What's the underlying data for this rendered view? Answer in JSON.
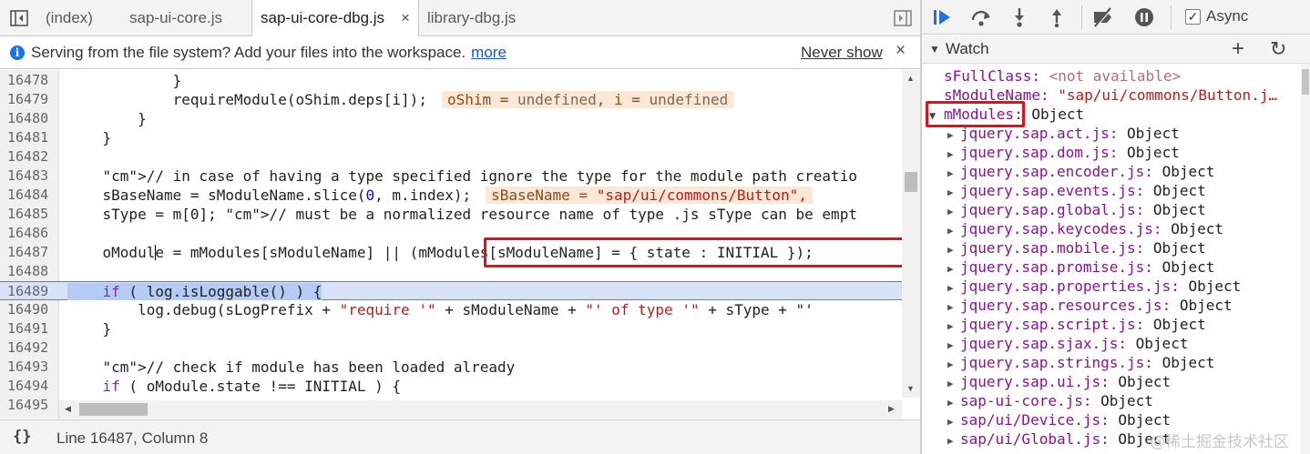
{
  "editor": {
    "tabs": [
      {
        "label": "(index)"
      },
      {
        "label": "sap-ui-core.js"
      },
      {
        "label": "sap-ui-core-dbg.js",
        "active": true
      },
      {
        "label": "library-dbg.js"
      }
    ],
    "tab_close": "×",
    "infobar": {
      "message": "Serving from the file system? Add your files into the workspace.",
      "link": "more",
      "never_show": "Never show",
      "close": "×"
    },
    "lines": [
      {
        "n": "16478",
        "code": "            }"
      },
      {
        "n": "16479",
        "code": "            requireModule(oShim.deps[i]);"
      },
      {
        "n": "16480",
        "code": "        }"
      },
      {
        "n": "16481",
        "code": "    }"
      },
      {
        "n": "16482",
        "code": ""
      },
      {
        "n": "16483",
        "code": "    // in case of having a type specified ignore the type for the module path creatio"
      },
      {
        "n": "16484",
        "code": "    sBaseName = sModuleName.slice(0, m.index);"
      },
      {
        "n": "16485",
        "code": "    sType = m[0]; // must be a normalized resource name of type .js sType can be empt"
      },
      {
        "n": "16486",
        "code": ""
      },
      {
        "n": "16487",
        "code": "    oModule = mModules[sModuleName] || (mModules[sModuleName] = { state : INITIAL });"
      },
      {
        "n": "16488",
        "code": ""
      },
      {
        "n": "16489",
        "code": "    if ( log.isLoggable() ) {"
      },
      {
        "n": "16490",
        "code": "        log.debug(sLogPrefix + \"require '\" + sModuleName + \"' of type '\" + sType + \"'"
      },
      {
        "n": "16491",
        "code": "    }"
      },
      {
        "n": "16492",
        "code": ""
      },
      {
        "n": "16493",
        "code": "    // check if module has been loaded already"
      },
      {
        "n": "16494",
        "code": "    if ( oModule.state !== INITIAL ) {"
      },
      {
        "n": "16495",
        "code": ""
      }
    ],
    "inline_values": {
      "line_16479": {
        "a": "oShim = ",
        "a_val": "undefined",
        "b": ", i = ",
        "b_val": "undefined"
      },
      "line_16484": {
        "a": "sBaseName = ",
        "a_val": "\"sap/ui/commons/Button\","
      }
    },
    "status": {
      "braces": "{}",
      "position": "Line 16487, Column 8"
    }
  },
  "debugger": {
    "async_label": "Async",
    "async_checked": true,
    "watch": {
      "title": "Watch",
      "add": "+",
      "refresh": "↻",
      "entries": [
        {
          "key": "sFullClass",
          "value": "<not available>",
          "kind": "na"
        },
        {
          "key": "sModuleName",
          "value": "\"sap/ui/commons/Button.j…",
          "kind": "str"
        },
        {
          "key": "mModules",
          "value": "Object",
          "kind": "obj",
          "expanded": true
        }
      ],
      "children": [
        "jquery.sap.act.js",
        "jquery.sap.dom.js",
        "jquery.sap.encoder.js",
        "jquery.sap.events.js",
        "jquery.sap.global.js",
        "jquery.sap.keycodes.js",
        "jquery.sap.mobile.js",
        "jquery.sap.promise.js",
        "jquery.sap.properties.js",
        "jquery.sap.resources.js",
        "jquery.sap.script.js",
        "jquery.sap.sjax.js",
        "jquery.sap.strings.js",
        "jquery.sap.ui.js",
        "sap-ui-core.js",
        "sap/ui/Device.js",
        "sap/ui/Global.js"
      ],
      "child_value": "Object"
    }
  },
  "watermark": "@稀土掘金技术社区",
  "colors": {
    "highlight_line": "#d8e3fa",
    "red_box": "#d9141a",
    "inline_value_bg": "#fde7d5",
    "watch_key": "#881391"
  }
}
